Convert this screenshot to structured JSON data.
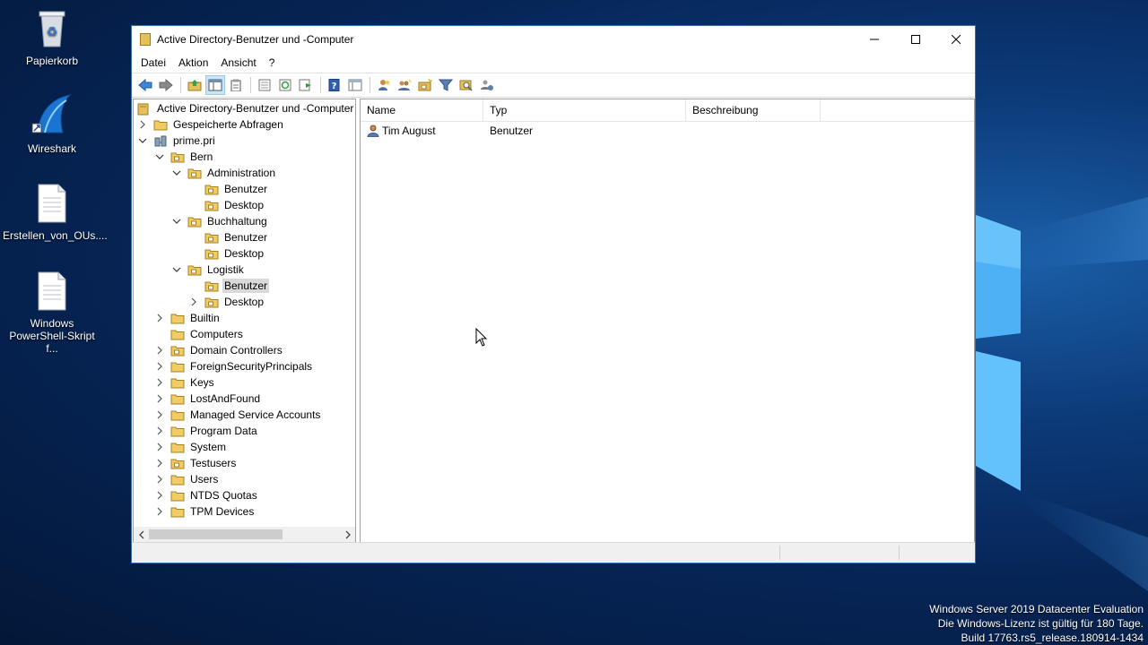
{
  "desktop": {
    "icons": [
      {
        "label": "Papierkorb",
        "icon": "recycle-bin-icon"
      },
      {
        "label": "Wireshark",
        "icon": "wireshark-icon"
      },
      {
        "label": "Erstellen_von_OUs....",
        "icon": "document-icon"
      },
      {
        "label_line1": "Windows",
        "label_line2": "PowerShell-Skript f...",
        "icon": "script-document-icon"
      }
    ],
    "watermark": {
      "line1": "Windows Server 2019 Datacenter Evaluation",
      "line2": "Die Windows-Lizenz ist gültig für 180 Tage.",
      "line3": "Build 17763.rs5_release.180914-1434"
    }
  },
  "window": {
    "title": "Active Directory-Benutzer und -Computer",
    "controls": [
      "minimize",
      "maximize",
      "close"
    ],
    "menu": [
      "Datei",
      "Aktion",
      "Ansicht",
      "?"
    ],
    "toolbar": [
      "back-icon",
      "forward-icon",
      "up-folder-icon",
      "show-hide-tree-icon",
      "clipboard-icon",
      "properties-icon",
      "refresh-icon",
      "export-list-icon",
      "help-icon",
      "console-tree-icon",
      "new-user-icon",
      "new-group-icon",
      "new-ou-icon",
      "filter-icon",
      "find-icon",
      "add-to-group-icon"
    ]
  },
  "tree": {
    "root": "Active Directory-Benutzer und -Computer",
    "items": [
      {
        "label": "Gespeicherte Abfragen",
        "level": 1,
        "expander": "collapsed",
        "icon": "folder-icon"
      },
      {
        "label": "prime.pri",
        "level": 1,
        "expander": "expanded",
        "icon": "domain-icon"
      },
      {
        "label": "Bern",
        "level": 2,
        "expander": "expanded",
        "icon": "ou-icon"
      },
      {
        "label": "Administration",
        "level": 3,
        "expander": "expanded",
        "icon": "ou-icon"
      },
      {
        "label": "Benutzer",
        "level": 4,
        "expander": "none",
        "icon": "ou-icon"
      },
      {
        "label": "Desktop",
        "level": 4,
        "expander": "none",
        "icon": "ou-icon"
      },
      {
        "label": "Buchhaltung",
        "level": 3,
        "expander": "expanded",
        "icon": "ou-icon"
      },
      {
        "label": "Benutzer",
        "level": 4,
        "expander": "none",
        "icon": "ou-icon"
      },
      {
        "label": "Desktop",
        "level": 4,
        "expander": "none",
        "icon": "ou-icon"
      },
      {
        "label": "Logistik",
        "level": 3,
        "expander": "expanded",
        "icon": "ou-icon"
      },
      {
        "label": "Benutzer",
        "level": 4,
        "expander": "none",
        "icon": "ou-icon",
        "selected": true
      },
      {
        "label": "Desktop",
        "level": 4,
        "expander": "collapsed",
        "icon": "ou-icon"
      },
      {
        "label": "Builtin",
        "level": 2,
        "expander": "collapsed",
        "icon": "folder-icon"
      },
      {
        "label": "Computers",
        "level": 2,
        "expander": "none",
        "icon": "folder-icon"
      },
      {
        "label": "Domain Controllers",
        "level": 2,
        "expander": "collapsed",
        "icon": "ou-icon"
      },
      {
        "label": "ForeignSecurityPrincipals",
        "level": 2,
        "expander": "collapsed",
        "icon": "folder-icon"
      },
      {
        "label": "Keys",
        "level": 2,
        "expander": "collapsed",
        "icon": "folder-icon"
      },
      {
        "label": "LostAndFound",
        "level": 2,
        "expander": "collapsed",
        "icon": "folder-icon"
      },
      {
        "label": "Managed Service Accounts",
        "level": 2,
        "expander": "collapsed",
        "icon": "folder-icon"
      },
      {
        "label": "Program Data",
        "level": 2,
        "expander": "collapsed",
        "icon": "folder-icon"
      },
      {
        "label": "System",
        "level": 2,
        "expander": "collapsed",
        "icon": "folder-icon"
      },
      {
        "label": "Testusers",
        "level": 2,
        "expander": "collapsed",
        "icon": "ou-icon"
      },
      {
        "label": "Users",
        "level": 2,
        "expander": "collapsed",
        "icon": "folder-icon"
      },
      {
        "label": "NTDS Quotas",
        "level": 2,
        "expander": "collapsed",
        "icon": "folder-icon"
      },
      {
        "label": "TPM Devices",
        "level": 2,
        "expander": "collapsed",
        "icon": "folder-icon"
      }
    ]
  },
  "list": {
    "columns": [
      "Name",
      "Typ",
      "Beschreibung"
    ],
    "rows": [
      {
        "name": "Tim August",
        "type": "Benutzer",
        "description": "",
        "icon": "user-icon"
      }
    ]
  },
  "colors": {
    "window_border": "#3a6ea5",
    "selection": "#d9d9d9",
    "folder_yellow": "#e8c05a"
  }
}
